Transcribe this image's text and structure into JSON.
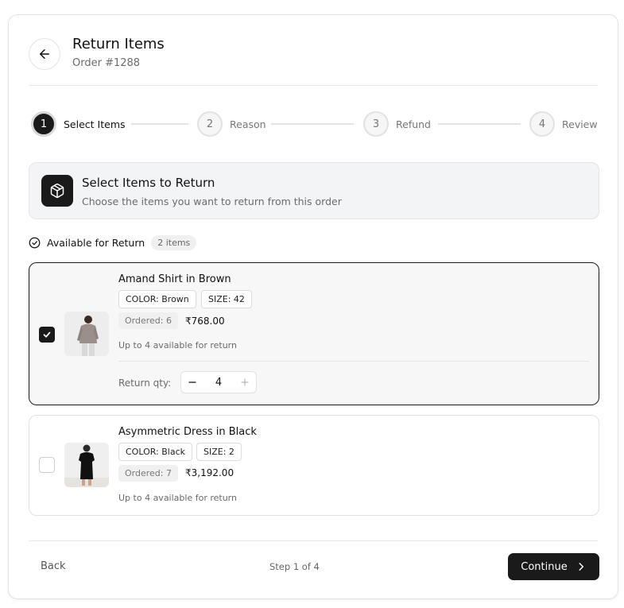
{
  "header": {
    "title": "Return Items",
    "order_number": "Order #1288"
  },
  "steps": [
    {
      "number": "1",
      "label": "Select Items",
      "active": true
    },
    {
      "number": "2",
      "label": "Reason",
      "active": false
    },
    {
      "number": "3",
      "label": "Refund",
      "active": false
    },
    {
      "number": "4",
      "label": "Review",
      "active": false
    }
  ],
  "section": {
    "icon": "package-icon",
    "title": "Select Items to Return",
    "description": "Choose the items you want to return from this order"
  },
  "available": {
    "label": "Available for Return",
    "count_badge": "2 items"
  },
  "items": [
    {
      "name": "Amand Shirt in Brown",
      "color": "COLOR: Brown",
      "size": "SIZE: 42",
      "ordered": "Ordered: 6",
      "price": "₹768.00",
      "availability": "Up to 4 available for return",
      "selected": true,
      "qty_label": "Return qty:",
      "qty": "4"
    },
    {
      "name": "Asymmetric Dress in Black",
      "color": "COLOR: Black",
      "size": "SIZE: 2",
      "ordered": "Ordered: 7",
      "price": "₹3,192.00",
      "availability": "Up to 4 available for return",
      "selected": false
    }
  ],
  "footer": {
    "back_label": "Back",
    "step_indicator": "Step 1 of 4",
    "continue_label": "Continue"
  },
  "colors": {
    "accent": "#1a1a1a",
    "muted_text": "#6b6b6b",
    "border": "#e2e2e2"
  }
}
